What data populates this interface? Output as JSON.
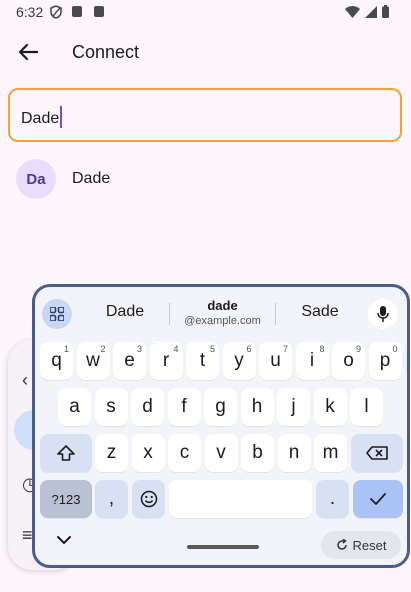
{
  "status_bar": {
    "time": "6:32"
  },
  "app_bar": {
    "title": "Connect"
  },
  "search": {
    "value": "Dade"
  },
  "results": [
    {
      "initials": "Da",
      "name": "Dade"
    }
  ],
  "keyboard": {
    "suggestions": [
      {
        "text": "Dade",
        "sub": ""
      },
      {
        "text": "dade",
        "sub": "@example.com"
      },
      {
        "text": "Sade",
        "sub": ""
      }
    ],
    "row1": [
      {
        "c": "q",
        "n": "1"
      },
      {
        "c": "w",
        "n": "2"
      },
      {
        "c": "e",
        "n": "3"
      },
      {
        "c": "r",
        "n": "4"
      },
      {
        "c": "t",
        "n": "5"
      },
      {
        "c": "y",
        "n": "6"
      },
      {
        "c": "u",
        "n": "7"
      },
      {
        "c": "i",
        "n": "8"
      },
      {
        "c": "o",
        "n": "9"
      },
      {
        "c": "p",
        "n": "0"
      }
    ],
    "row2": [
      "a",
      "s",
      "d",
      "f",
      "g",
      "h",
      "j",
      "k",
      "l"
    ],
    "row3": [
      "z",
      "x",
      "c",
      "v",
      "b",
      "n",
      "m"
    ],
    "symbols_label": "?123",
    "comma": ",",
    "period": ".",
    "reset_label": "Reset"
  }
}
